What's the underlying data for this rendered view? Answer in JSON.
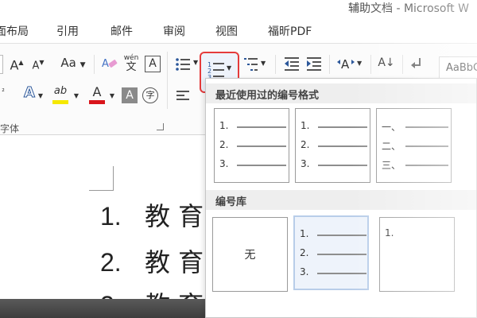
{
  "window": {
    "title": "辅助文档 - Microsoft W"
  },
  "tabs": [
    {
      "label": "面布局"
    },
    {
      "label": "引用"
    },
    {
      "label": "邮件"
    },
    {
      "label": "审阅"
    },
    {
      "label": "视图"
    },
    {
      "label": "福昕PDF"
    }
  ],
  "ribbon": {
    "font_group_label": "字体",
    "change_case_label": "Aa",
    "grow_font_label": "A",
    "shrink_font_label": "A",
    "phonetic_label": "wén",
    "phonetic_char": "文",
    "char_border_label": "A",
    "text_effect_label": "A",
    "highlight_label": "ab",
    "font_color_label": "A",
    "char_shading_label": "A",
    "enclosed_char_label": "字",
    "sort_label": "A↓",
    "styles_preview": "AaBbC",
    "highlight_color": "#f5e800",
    "font_color": "#d9151b",
    "accent_color": "#2b579a",
    "numbering_highlight_color": "#e53b3b"
  },
  "document": {
    "items": [
      {
        "num": "1.",
        "text": "教 育"
      },
      {
        "num": "2.",
        "text": "教 育"
      },
      {
        "num": "3.",
        "text": "教 育"
      }
    ]
  },
  "dropdown": {
    "recent_header": "最近使用过的编号格式",
    "library_header": "编号库",
    "recent_formats": [
      {
        "labels": [
          "1.",
          "2.",
          "3."
        ]
      },
      {
        "labels": [
          "1.",
          "2.",
          "3."
        ]
      },
      {
        "labels": [
          "一、",
          "二、",
          "三、"
        ]
      }
    ],
    "library_formats": [
      {
        "none_label": "无"
      },
      {
        "labels": [
          "1.",
          "2.",
          "3."
        ]
      },
      {
        "labels": [
          "1.",
          "",
          ""
        ]
      }
    ]
  }
}
